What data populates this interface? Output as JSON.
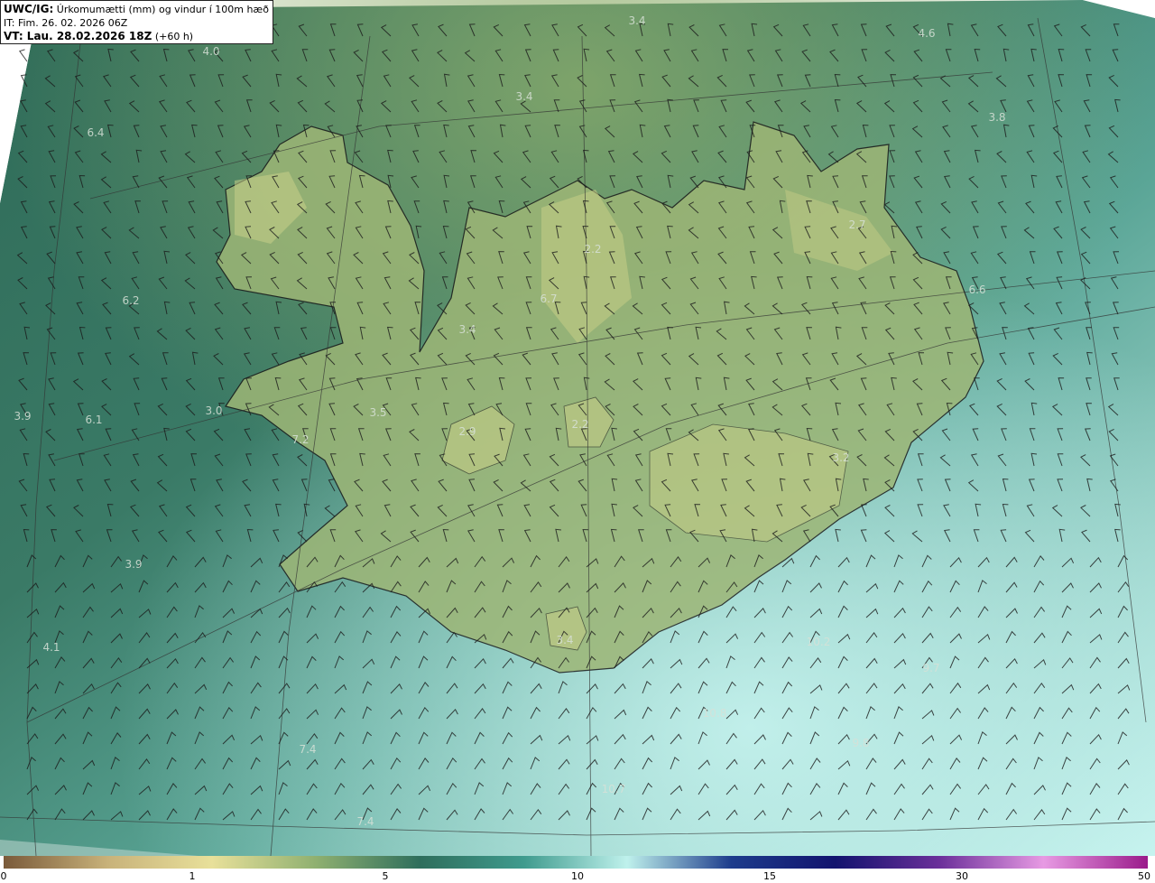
{
  "title": {
    "product": "UWC/IG:",
    "description": "Úrkomumætti (mm) og vindur í 100m hæð",
    "issue_time": "IT: Fim. 26. 02. 2026 06Z",
    "valid_prefix": "VT: Lau. 28.02.2026 18Z",
    "valid_suffix": "(+60 h)"
  },
  "value_labels": [
    {
      "text": "3.4"
    },
    {
      "text": "4.6"
    },
    {
      "text": "4.0"
    },
    {
      "text": "3.4"
    },
    {
      "text": "3.8"
    },
    {
      "text": "6.4"
    },
    {
      "text": "2.7"
    },
    {
      "text": "2.2"
    },
    {
      "text": "6.6"
    },
    {
      "text": "6.2"
    },
    {
      "text": "6.7"
    },
    {
      "text": "3.4"
    },
    {
      "text": "3.9"
    },
    {
      "text": "6.1"
    },
    {
      "text": "3.0"
    },
    {
      "text": "3.5"
    },
    {
      "text": "2.9"
    },
    {
      "text": "2.2"
    },
    {
      "text": "7.2"
    },
    {
      "text": "3.2"
    },
    {
      "text": "3.9"
    },
    {
      "text": "4.1"
    },
    {
      "text": "3.4"
    },
    {
      "text": "10.2"
    },
    {
      "text": "9.7"
    },
    {
      "text": "10.8"
    },
    {
      "text": "7.4"
    },
    {
      "text": "9.8"
    },
    {
      "text": "10.7"
    },
    {
      "text": "7.4"
    }
  ],
  "colorbar": {
    "ticks": [
      "0",
      "1",
      "5",
      "10",
      "15",
      "30",
      "50"
    ],
    "tick_values": [
      0,
      1,
      5,
      10,
      15,
      30,
      50
    ],
    "colors": [
      "#7a5a3a",
      "#c8b27a",
      "#e8e09a",
      "#8fb070",
      "#2e6e5c",
      "#3f9b8e",
      "#bff1ec",
      "#1d3c8c",
      "#12136e",
      "#6b2f9a",
      "#e79ae3",
      "#9a1a8a"
    ]
  },
  "colors": {
    "sea_dark": "#2f6f5c",
    "sea_light": "#a9e4e0",
    "land_light": "#b6c57e",
    "coastline": "#1a1a1a",
    "graticule": "#333333"
  }
}
